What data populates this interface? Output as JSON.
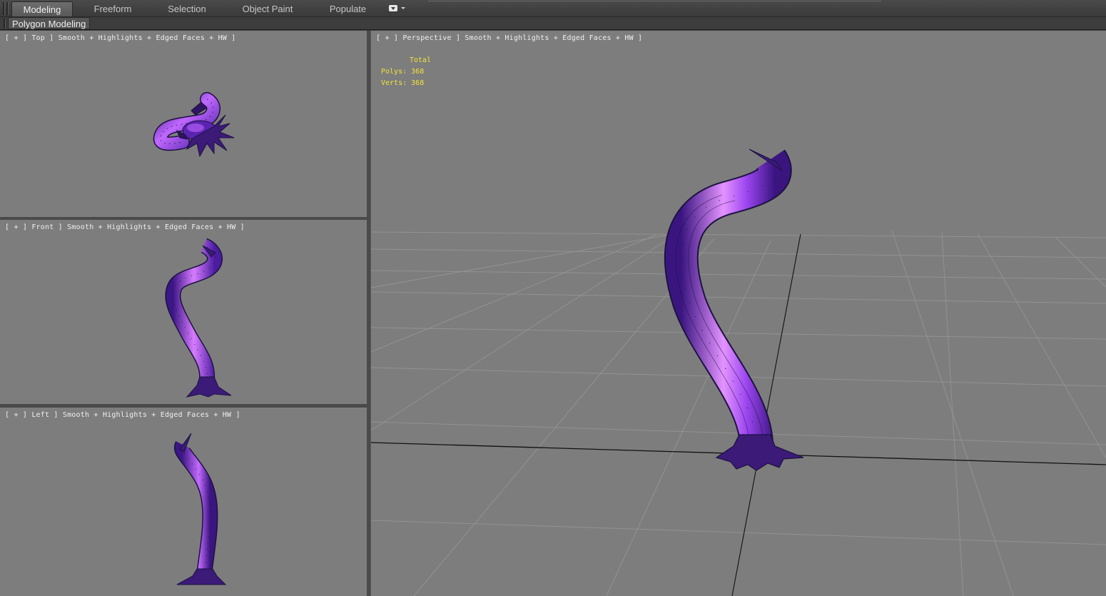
{
  "ribbon": {
    "tabs": [
      {
        "label": "Modeling",
        "active": true
      },
      {
        "label": "Freeform",
        "active": false
      },
      {
        "label": "Selection",
        "active": false
      },
      {
        "label": "Object Paint",
        "active": false
      },
      {
        "label": "Populate",
        "active": false
      }
    ],
    "menu_icon": "dropdown-box-icon",
    "sub_panel": "Polygon Modeling"
  },
  "viewports": {
    "top": {
      "label": "[ + ] Top ] Smooth + Highlights + Edged Faces + HW ]"
    },
    "front": {
      "label": "[ + ] Front ] Smooth + Highlights + Edged Faces + HW ]"
    },
    "left": {
      "label": "[ + ] Left ] Smooth + Highlights + Edged Faces + HW ]"
    },
    "perspective": {
      "label": "[ + ] Perspective ] Smooth + Highlights + Edged Faces + HW ]",
      "stats": {
        "header": "Total",
        "polys_label": "Polys:",
        "polys": "368",
        "verts_label": "Verts:",
        "verts": "368"
      }
    }
  },
  "colors": {
    "viewport_bg": "#7d7d7d",
    "model": "#7a2fd0",
    "model_highlight": "#d77cff",
    "wire": "#1c1240",
    "stats_text": "#f2e23a"
  }
}
